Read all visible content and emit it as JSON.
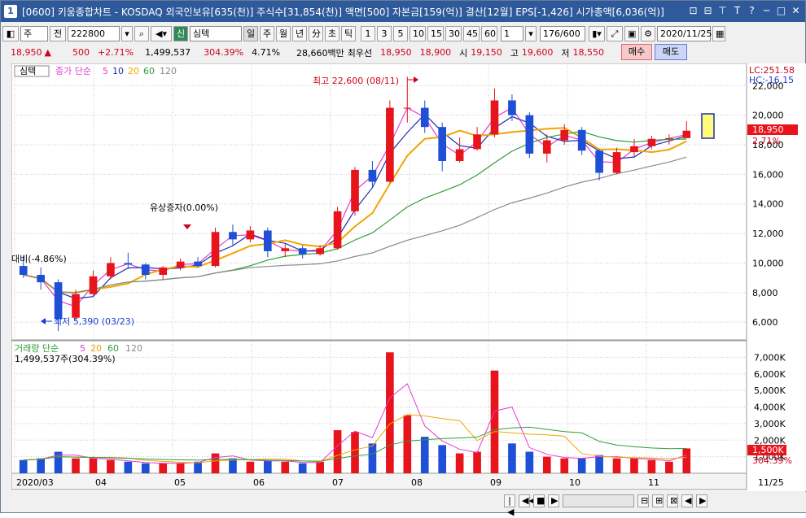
{
  "window": {
    "badge": "1",
    "title": "[0600] 키움종합차트 - KOSDAQ 외국인보유[635(천)] 주식수[31,854(천)] 액면[500] 자본금[159(억)] 결산[12월] EPS[-1,426] 시가총액[6,036(억)]",
    "controls": [
      "⊡",
      "⊟",
      "⊤",
      "T",
      "?",
      "─",
      "□",
      "✕"
    ]
  },
  "toolbar": {
    "stock_type": "주",
    "prefix": "전",
    "code": "222800",
    "signal": "신",
    "stock_name": "심텍",
    "periods": [
      "일",
      "주",
      "월",
      "년",
      "分",
      "초",
      "틱"
    ],
    "selected_period": "일",
    "intervals": [
      "1",
      "3",
      "5",
      "10",
      "15",
      "30",
      "45",
      "60"
    ],
    "count_value": "1",
    "range_label": "176/600",
    "date": "2020/11/25"
  },
  "quote": {
    "price": "18,950",
    "change": "500",
    "change_pct": "+2.71%",
    "volume": "1,499,537",
    "volume_ratio": "304.39%",
    "turnover": "4.71%",
    "amount": "28,660백만",
    "best_label": "최우선",
    "ask": "18,950",
    "bid": "18,900",
    "open_label": "시",
    "open": "19,150",
    "high_label": "고",
    "high": "19,600",
    "low_label": "저",
    "low": "18,550",
    "buy_label": "매수",
    "sell_label": "매도"
  },
  "price_panel": {
    "name_tag": "심텍",
    "legend_prefix": "종가 단순",
    "ma_labels": [
      "5",
      "10",
      "20",
      "60",
      "120"
    ],
    "lc_label": "LC:251.58",
    "hc_label": "HC:-16.15",
    "current_price_label": "18,950",
    "current_pct_label": "2.71%",
    "high_annotation": "최고 22,600 (08/11)",
    "low_annotation": "최저 5,390 (03/23)",
    "event_annotation": "유상증자(0.00%)",
    "left_annotation": "대비(-4.86%)",
    "y_ticks": [
      "22,000",
      "20,000",
      "18,000",
      "16,000",
      "14,000",
      "12,000",
      "10,000",
      "8,000",
      "6,000"
    ]
  },
  "volume_panel": {
    "legend_prefix": "거래량 단순",
    "ma_labels": [
      "5",
      "20",
      "60",
      "120"
    ],
    "value_label": "1,499,537주(304.39%)",
    "current_label": "1,500K",
    "current_pct_label": "304.39%",
    "y_ticks": [
      "7,000K",
      "6,000K",
      "5,000K",
      "4,000K",
      "3,000K",
      "2,000K",
      "1,000K"
    ]
  },
  "x_axis": {
    "labels": [
      "2020/03",
      "04",
      "05",
      "06",
      "07",
      "08",
      "09",
      "10",
      "11"
    ],
    "right_label": "11/25"
  },
  "colors": {
    "up": "#e8141b",
    "down": "#1e4fd6",
    "ma5": "#e53bd1",
    "ma10": "#1f2fb0",
    "ma20": "#f2a400",
    "ma60": "#2f9e3a",
    "ma120": "#8a8a8a",
    "title_bar": "#2e5a9c"
  },
  "chart_data": {
    "type": "candlestick",
    "y_price_range": [
      4800,
      23500
    ],
    "y_volume_range_k": [
      0,
      8000
    ],
    "candles_weekly_approx": [
      {
        "o": 9800,
        "h": 10500,
        "l": 9000,
        "c": 9200,
        "v": 800
      },
      {
        "o": 9200,
        "h": 9700,
        "l": 8200,
        "c": 8700,
        "v": 900
      },
      {
        "o": 8700,
        "h": 8900,
        "l": 5390,
        "c": 6200,
        "v": 1300
      },
      {
        "o": 6300,
        "h": 8200,
        "l": 6100,
        "c": 7900,
        "v": 900
      },
      {
        "o": 7900,
        "h": 9500,
        "l": 7800,
        "c": 9100,
        "v": 900
      },
      {
        "o": 9100,
        "h": 10400,
        "l": 8900,
        "c": 10000,
        "v": 800
      },
      {
        "o": 10000,
        "h": 10700,
        "l": 9600,
        "c": 9900,
        "v": 700
      },
      {
        "o": 9900,
        "h": 10000,
        "l": 8900,
        "c": 9200,
        "v": 600
      },
      {
        "o": 9200,
        "h": 9800,
        "l": 8900,
        "c": 9700,
        "v": 600
      },
      {
        "o": 9700,
        "h": 10300,
        "l": 9500,
        "c": 10100,
        "v": 600
      },
      {
        "o": 10100,
        "h": 10400,
        "l": 9700,
        "c": 9800,
        "v": 700
      },
      {
        "o": 9800,
        "h": 12400,
        "l": 9700,
        "c": 12100,
        "v": 1200
      },
      {
        "o": 12100,
        "h": 12600,
        "l": 11200,
        "c": 11600,
        "v": 900
      },
      {
        "o": 11600,
        "h": 12500,
        "l": 11400,
        "c": 12200,
        "v": 700
      },
      {
        "o": 12200,
        "h": 12400,
        "l": 10400,
        "c": 10800,
        "v": 800
      },
      {
        "o": 10800,
        "h": 11300,
        "l": 10400,
        "c": 11000,
        "v": 700
      },
      {
        "o": 11000,
        "h": 11200,
        "l": 10300,
        "c": 10600,
        "v": 600
      },
      {
        "o": 10600,
        "h": 11200,
        "l": 10500,
        "c": 11000,
        "v": 700
      },
      {
        "o": 11000,
        "h": 13800,
        "l": 10900,
        "c": 13500,
        "v": 2600
      },
      {
        "o": 13500,
        "h": 16500,
        "l": 13200,
        "c": 16300,
        "v": 2500
      },
      {
        "o": 16300,
        "h": 16900,
        "l": 15100,
        "c": 15500,
        "v": 1800
      },
      {
        "o": 15500,
        "h": 21000,
        "l": 15400,
        "c": 20500,
        "v": 7300
      },
      {
        "o": 20500,
        "h": 22600,
        "l": 19500,
        "c": 20500,
        "v": 3500
      },
      {
        "o": 20500,
        "h": 21000,
        "l": 18800,
        "c": 19200,
        "v": 2200
      },
      {
        "o": 19200,
        "h": 19500,
        "l": 16200,
        "c": 16900,
        "v": 1700
      },
      {
        "o": 16900,
        "h": 18500,
        "l": 16800,
        "c": 17700,
        "v": 1200
      },
      {
        "o": 17700,
        "h": 19200,
        "l": 17600,
        "c": 18700,
        "v": 1300
      },
      {
        "o": 18700,
        "h": 21800,
        "l": 18500,
        "c": 21000,
        "v": 6200
      },
      {
        "o": 21000,
        "h": 21400,
        "l": 19600,
        "c": 20000,
        "v": 1800
      },
      {
        "o": 20000,
        "h": 20200,
        "l": 17100,
        "c": 17400,
        "v": 1300
      },
      {
        "o": 17400,
        "h": 18700,
        "l": 16800,
        "c": 18300,
        "v": 1000
      },
      {
        "o": 18300,
        "h": 19400,
        "l": 18000,
        "c": 19000,
        "v": 900
      },
      {
        "o": 19000,
        "h": 19200,
        "l": 17300,
        "c": 17600,
        "v": 900
      },
      {
        "o": 17600,
        "h": 17700,
        "l": 15600,
        "c": 16100,
        "v": 1100
      },
      {
        "o": 16100,
        "h": 17800,
        "l": 16000,
        "c": 17500,
        "v": 900
      },
      {
        "o": 17500,
        "h": 18400,
        "l": 17200,
        "c": 17900,
        "v": 900
      },
      {
        "o": 17900,
        "h": 18600,
        "l": 17700,
        "c": 18400,
        "v": 800
      },
      {
        "o": 18400,
        "h": 18700,
        "l": 18000,
        "c": 18450,
        "v": 700
      },
      {
        "o": 18450,
        "h": 19600,
        "l": 18550,
        "c": 18950,
        "v": 1500
      }
    ]
  }
}
